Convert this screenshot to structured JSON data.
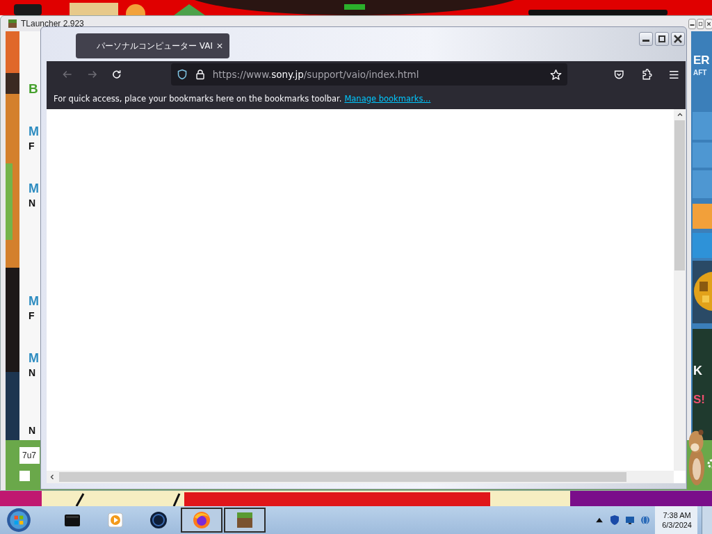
{
  "tlauncher": {
    "title": "TLauncher 2.923",
    "left_texts": [
      {
        "text": "B",
        "kind": "heading"
      },
      {
        "text": "M",
        "kind": "title"
      },
      {
        "text": "F",
        "kind": "detail"
      },
      {
        "text": "M",
        "kind": "title"
      },
      {
        "text": "N",
        "kind": "detail"
      },
      {
        "text": "M",
        "kind": "title"
      },
      {
        "text": "F",
        "kind": "detail"
      },
      {
        "text": "M",
        "kind": "title"
      },
      {
        "text": "N",
        "kind": "detail"
      },
      {
        "text": "N",
        "kind": "detail"
      }
    ],
    "right_texts": [
      {
        "text": "ER",
        "kind": "logo"
      },
      {
        "text": "AFT",
        "kind": "logo-sub"
      },
      {
        "text": "K",
        "kind": "banner"
      },
      {
        "text": "S!",
        "kind": "banner-accent"
      }
    ],
    "username": "7u7",
    "checkbox": {
      "checked": false
    }
  },
  "firefox": {
    "tab": {
      "title": "パーソナルコンピューター VAI",
      "selected": true
    },
    "nav": [
      {
        "kind": "back",
        "disabled": true
      },
      {
        "kind": "forward",
        "disabled": true
      },
      {
        "kind": "reload",
        "disabled": false
      }
    ],
    "url": {
      "prefix": "https://www.",
      "domain": "sony.jp",
      "path": "/support/vaio/index.html"
    },
    "bookmarks_bar": {
      "text": "For quick access, place your bookmarks here on the bookmarks toolbar.",
      "link": "Manage bookmarks..."
    }
  },
  "taskbar": {
    "apps": [
      {
        "kind": "terminal",
        "open": false
      },
      {
        "kind": "media",
        "open": false
      },
      {
        "kind": "globe",
        "open": false
      },
      {
        "kind": "firefox",
        "open": true
      },
      {
        "kind": "minecraft",
        "open": true
      }
    ],
    "time": "7:38 AM",
    "date": "6/3/2024"
  }
}
